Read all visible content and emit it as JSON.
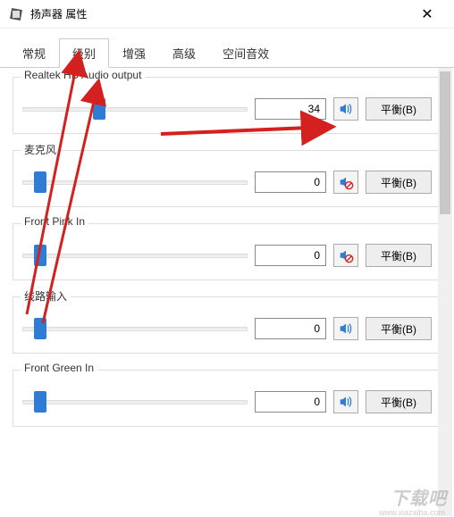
{
  "window": {
    "title": "扬声器 属性",
    "close_glyph": "✕"
  },
  "tabs": {
    "items": [
      {
        "label": "常规"
      },
      {
        "label": "级别"
      },
      {
        "label": "增强"
      },
      {
        "label": "高级"
      },
      {
        "label": "空间音效"
      }
    ],
    "active_index": 1
  },
  "groups": [
    {
      "title": "Realtek HD Audio output",
      "value": "34",
      "slider_percent": 34,
      "muted": false,
      "balance": "平衡(B)"
    },
    {
      "title": "麦克风",
      "value": "0",
      "slider_percent": 4,
      "muted": true,
      "balance": "平衡(B)"
    },
    {
      "title": "Front Pink In",
      "value": "0",
      "slider_percent": 4,
      "muted": true,
      "balance": "平衡(B)"
    },
    {
      "title": "线路输入",
      "value": "0",
      "slider_percent": 4,
      "muted": false,
      "balance": "平衡(B)"
    },
    {
      "title": "Front Green In",
      "value": "0",
      "slider_percent": 4,
      "muted": false,
      "balance": "平衡(B)"
    }
  ],
  "watermark": {
    "main": "下载吧",
    "url": "www.xiazaiba.com"
  },
  "colors": {
    "accent": "#2e7cd6",
    "arrow": "#d4201f"
  }
}
